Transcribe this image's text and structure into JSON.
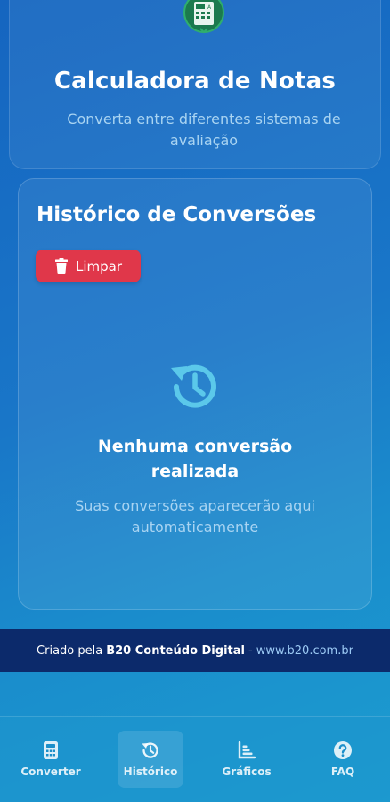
{
  "header": {
    "title": "Calculadora de Notas",
    "subtitle": "Converta entre diferentes sistemas de avaliação",
    "logo_icon": "calculator-logo-icon"
  },
  "history": {
    "title": "Histórico de Conversões",
    "clear_label": "Limpar",
    "clear_icon": "trash-icon",
    "empty_icon": "history-icon",
    "empty_title": "Nenhuma conversão realizada",
    "empty_description": "Suas conversões aparecerão aqui automaticamente"
  },
  "footer": {
    "prefix": "Criado pela",
    "brand": "B20 Conteúdo Digital",
    "separator": "-",
    "link": "www.b20.com.br"
  },
  "nav": {
    "items": [
      {
        "label": "Converter",
        "icon": "calculator-icon",
        "active": false
      },
      {
        "label": "Histórico",
        "icon": "history-icon",
        "active": true
      },
      {
        "label": "Gráficos",
        "icon": "chart-icon",
        "active": false
      },
      {
        "label": "FAQ",
        "icon": "question-icon",
        "active": false
      }
    ]
  },
  "colors": {
    "accent_red": "#e0374a",
    "footer_bg": "#0c2a6b",
    "subtitle_text": "#a9d4f2",
    "link_text": "#9ccaf5"
  }
}
